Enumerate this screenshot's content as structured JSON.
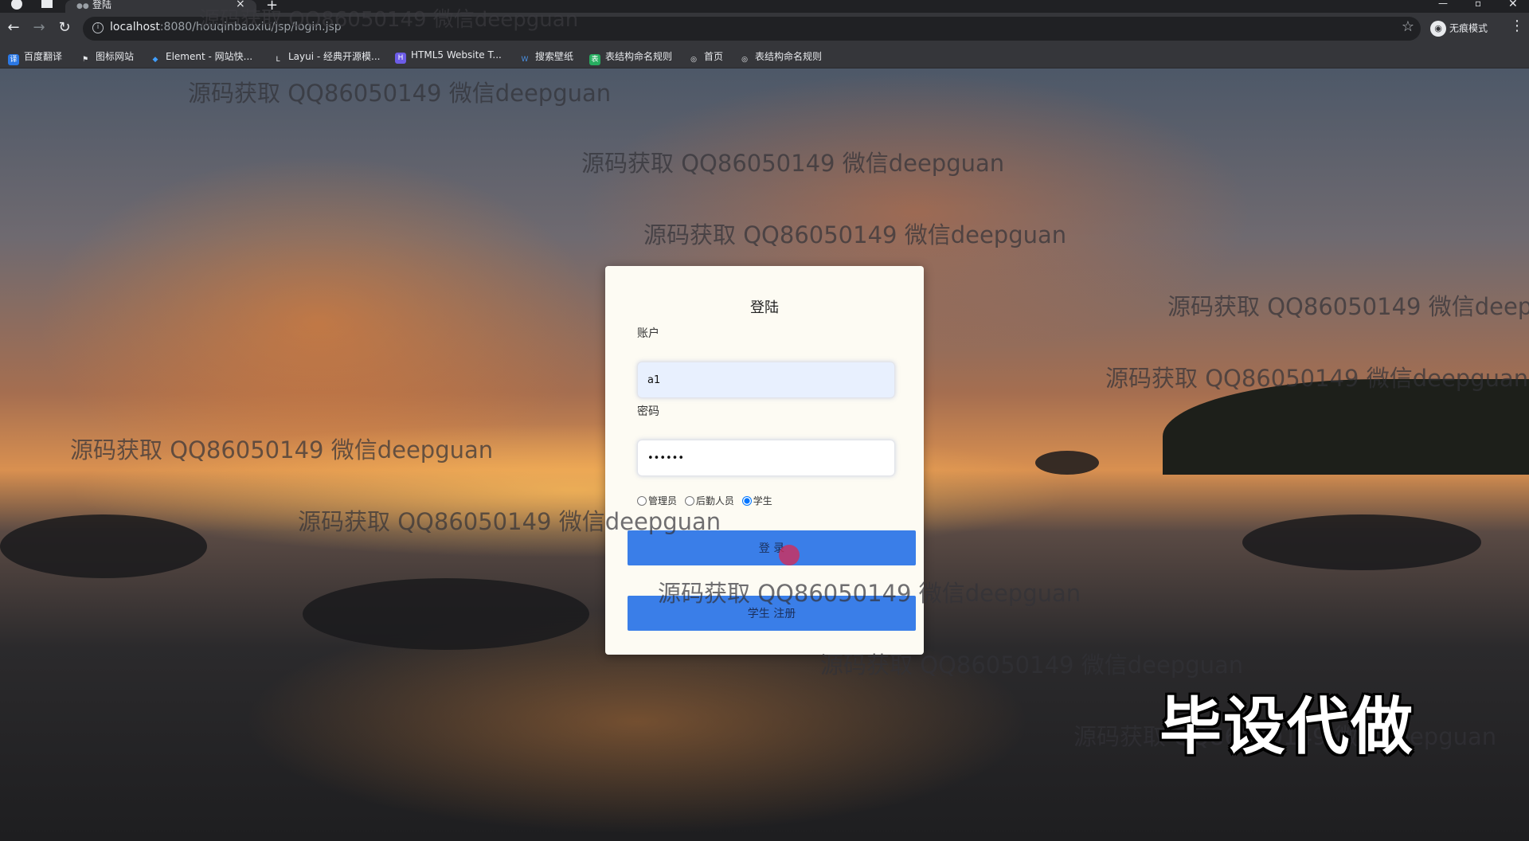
{
  "browser": {
    "tab_title": "登陆",
    "url_host": "localhost",
    "url_rest": ":8080/houqinbaoxiu/jsp/login.jsp",
    "incognito_label": "无痕模式"
  },
  "bookmarks": [
    {
      "label": "百度翻译",
      "color": "#2b78e4",
      "glyph": "译"
    },
    {
      "label": "图标网站",
      "color": "#e8eaed",
      "glyph": "⚑"
    },
    {
      "label": "Element - 网站快...",
      "color": "#409eff",
      "glyph": "◆"
    },
    {
      "label": "Layui - 经典开源模...",
      "color": "#e8eaed",
      "glyph": "L"
    },
    {
      "label": "HTML5 Website T...",
      "color": "#6c5ce7",
      "glyph": "H"
    },
    {
      "label": "搜索壁纸",
      "color": "#4a90e2",
      "glyph": "W"
    },
    {
      "label": "表结构命名规则",
      "color": "#27ae60",
      "glyph": "表"
    },
    {
      "label": "首页",
      "color": "#e8eaed",
      "glyph": "◎"
    },
    {
      "label": "表结构命名规则",
      "color": "#e8eaed",
      "glyph": "◎"
    }
  ],
  "login": {
    "title": "登陆",
    "account_label": "账户",
    "account_value": "a1",
    "password_label": "密码",
    "password_value": "123456",
    "roles": [
      "管理员",
      "后勤人员",
      "学生"
    ],
    "selected_role": "学生",
    "login_button": "登 录",
    "register_button": "学生 注册"
  },
  "watermark_text": "源码获取 QQ86050149 微信deepguan",
  "overlay_caption": "毕设代做"
}
